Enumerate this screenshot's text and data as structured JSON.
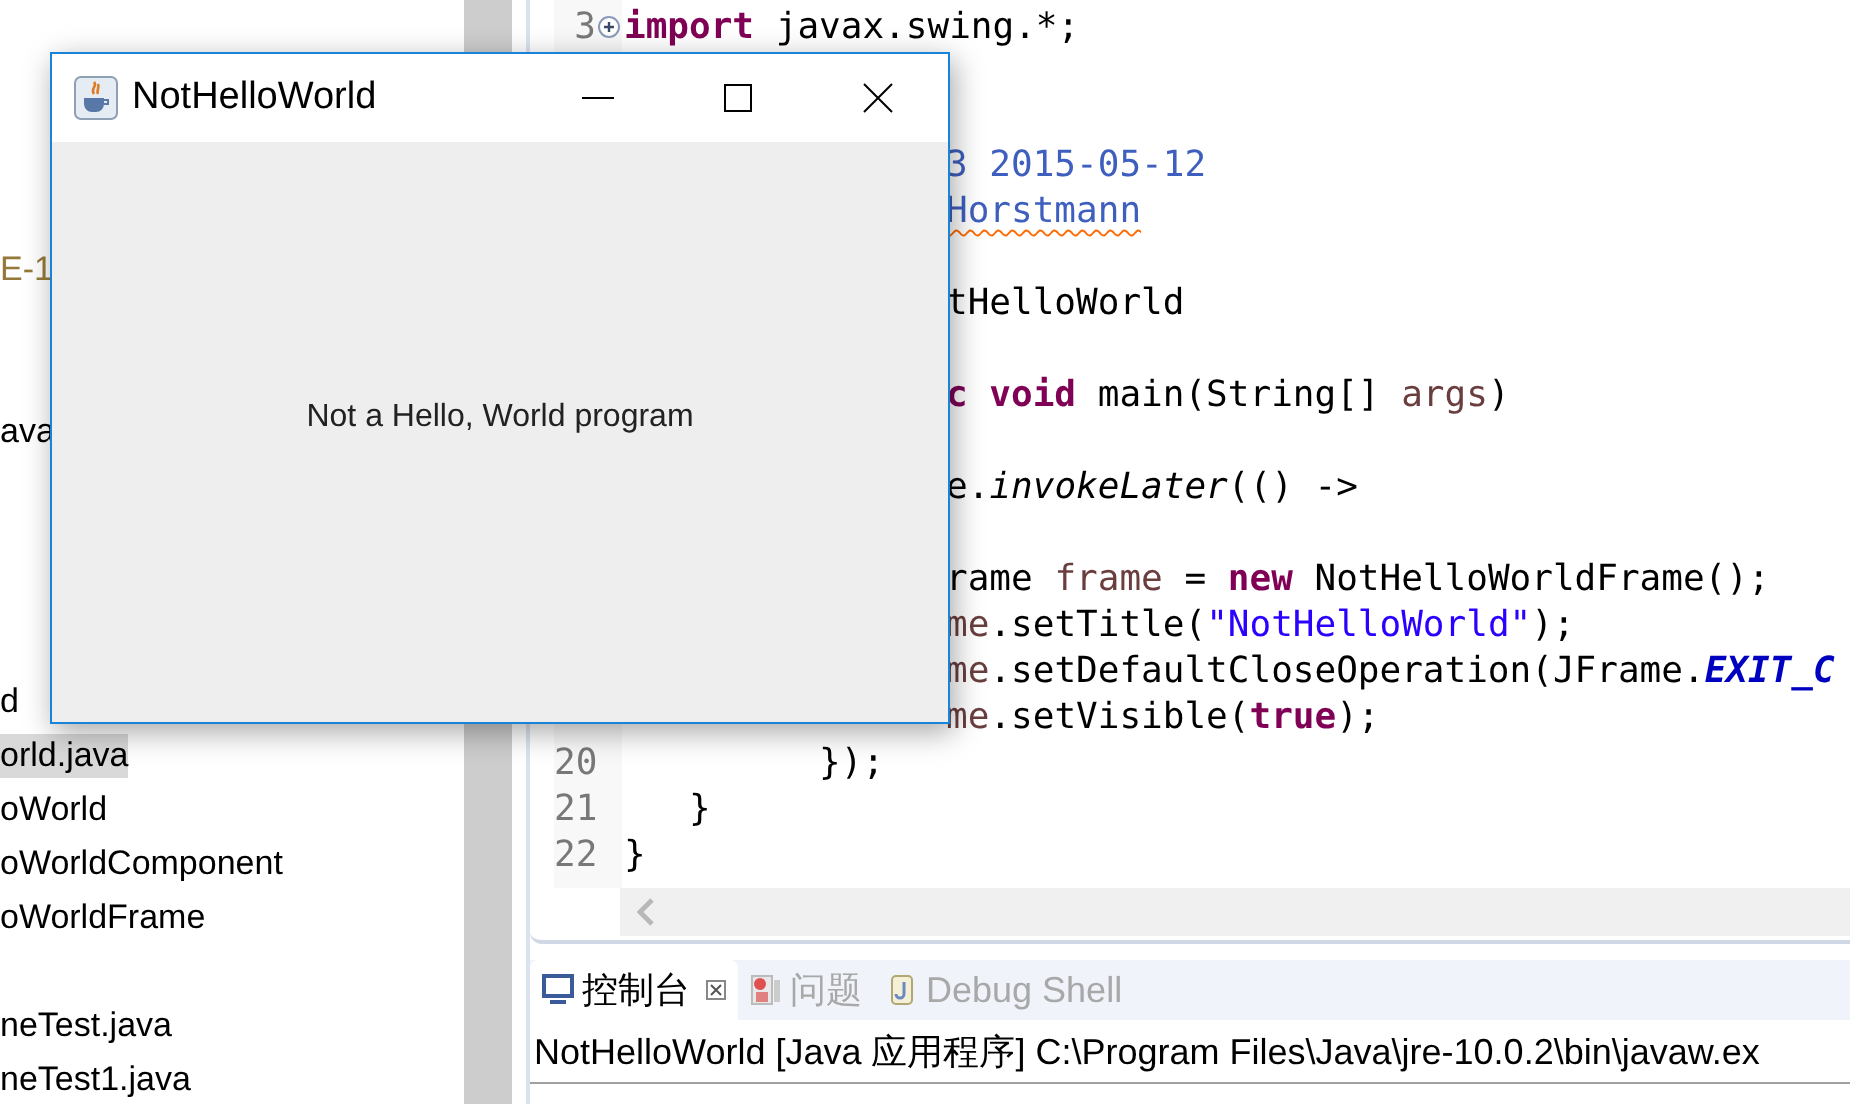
{
  "explorer": {
    "rows": [
      {
        "kind": "blank"
      },
      {
        "kind": "blank"
      },
      {
        "kind": "blank"
      },
      {
        "kind": "blank"
      },
      {
        "kind": "decoration",
        "text": "E-1",
        "selected": false
      },
      {
        "kind": "blank"
      },
      {
        "kind": "blank"
      },
      {
        "kind": "name",
        "text": "ava",
        "selected": false
      },
      {
        "kind": "blank"
      },
      {
        "kind": "blank"
      },
      {
        "kind": "blank"
      },
      {
        "kind": "blank"
      },
      {
        "kind": "name",
        "text": "d",
        "selected": false
      },
      {
        "kind": "name",
        "text": "orld.java",
        "selected": true
      },
      {
        "kind": "name",
        "text": "oWorld",
        "selected": false
      },
      {
        "kind": "name",
        "text": "oWorldComponent",
        "selected": false
      },
      {
        "kind": "name",
        "text": "oWorldFrame",
        "selected": false
      },
      {
        "kind": "blank"
      },
      {
        "kind": "name",
        "text": "neTest.java",
        "selected": false
      },
      {
        "kind": "name",
        "text": "neTest1.java",
        "selected": false
      }
    ]
  },
  "editor": {
    "lines": [
      {
        "kind": "code",
        "number": "3",
        "collapsed": true,
        "segments": [
          {
            "kind": "keyword",
            "text": "import"
          },
          {
            "kind": "plain",
            "text": " javax.swing.*;"
          }
        ]
      },
      {
        "kind": "blank"
      },
      {
        "kind": "blank"
      },
      {
        "kind": "tail",
        "segments": [
          {
            "kind": "doc",
            "text": "3 2015-05-12"
          }
        ]
      },
      {
        "kind": "tail",
        "segments": [
          {
            "kind": "doc-misspelled",
            "text": "Horstmann"
          }
        ]
      },
      {
        "kind": "blank"
      },
      {
        "kind": "tail",
        "segments": [
          {
            "kind": "plain",
            "text": "tHelloWorld"
          }
        ]
      },
      {
        "kind": "blank"
      },
      {
        "kind": "tail",
        "segments": [
          {
            "kind": "keyword",
            "text": "c void"
          },
          {
            "kind": "plain",
            "text": " main(String[] "
          },
          {
            "kind": "variable",
            "text": "args"
          },
          {
            "kind": "plain",
            "text": ")"
          }
        ]
      },
      {
        "kind": "blank"
      },
      {
        "kind": "tail",
        "segments": [
          {
            "kind": "plain",
            "text": "e."
          },
          {
            "kind": "italic",
            "text": "invokeLater"
          },
          {
            "kind": "plain",
            "text": "(() ->"
          }
        ]
      },
      {
        "kind": "blank"
      },
      {
        "kind": "tail",
        "segments": [
          {
            "kind": "plain",
            "text": "rame "
          },
          {
            "kind": "variable",
            "text": "frame"
          },
          {
            "kind": "plain",
            "text": " = "
          },
          {
            "kind": "keyword",
            "text": "new"
          },
          {
            "kind": "plain",
            "text": " NotHelloWorldFrame();"
          }
        ]
      },
      {
        "kind": "tail",
        "segments": [
          {
            "kind": "variable",
            "text": "me"
          },
          {
            "kind": "plain",
            "text": ".setTitle("
          },
          {
            "kind": "string",
            "text": "\"NotHelloWorld\""
          },
          {
            "kind": "plain",
            "text": ");"
          }
        ]
      },
      {
        "kind": "tail",
        "segments": [
          {
            "kind": "variable",
            "text": "me"
          },
          {
            "kind": "plain",
            "text": ".setDefaultCloseOperation(JFrame."
          },
          {
            "kind": "constant",
            "text": "EXIT_C"
          }
        ]
      },
      {
        "kind": "tail",
        "segments": [
          {
            "kind": "variable",
            "text": "me"
          },
          {
            "kind": "plain",
            "text": ".setVisible("
          },
          {
            "kind": "keyword",
            "text": "true"
          },
          {
            "kind": "plain",
            "text": ");"
          }
        ]
      },
      {
        "kind": "code",
        "number": "20",
        "segments": [
          {
            "kind": "plain",
            "text": "         });"
          }
        ]
      },
      {
        "kind": "code",
        "number": "21",
        "segments": [
          {
            "kind": "plain",
            "text": "   }"
          }
        ]
      },
      {
        "kind": "code",
        "number": "22",
        "segments": [
          {
            "kind": "plain",
            "text": "}"
          }
        ]
      }
    ]
  },
  "console": {
    "tabs": [
      {
        "kind": "console",
        "label": "控制台",
        "selected": true
      },
      {
        "kind": "problems",
        "label": "问题",
        "selected": false
      },
      {
        "kind": "shell",
        "label": "Debug Shell",
        "selected": false
      }
    ],
    "header": "NotHelloWorld [Java 应用程序] C:\\Program Files\\Java\\jre-10.0.2\\bin\\javaw.ex"
  },
  "window": {
    "title": "NotHelloWorld",
    "message": "Not a Hello, World program"
  }
}
